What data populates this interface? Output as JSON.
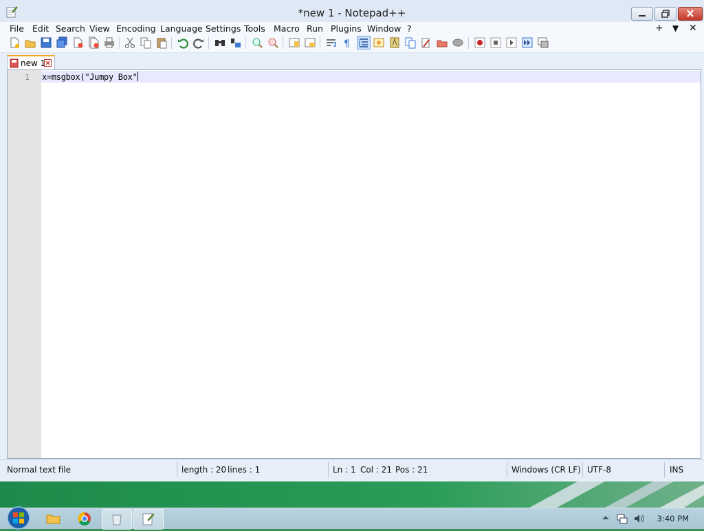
{
  "window": {
    "title": "*new 1 - Notepad++"
  },
  "menu": [
    "File",
    "Edit",
    "Search",
    "View",
    "Encoding",
    "Language",
    "Settings",
    "Tools",
    "Macro",
    "Run",
    "Plugins",
    "Window",
    "?"
  ],
  "menu_right": {
    "add": "+",
    "dropdown": "▼",
    "close": "✕"
  },
  "toolbar_icons": [
    "new-file-icon",
    "open-file-icon",
    "save-icon",
    "save-all-icon",
    "close-icon",
    "close-all-icon",
    "print-icon",
    "cut-icon",
    "copy-icon",
    "paste-icon",
    "undo-icon",
    "redo-icon",
    "find-icon",
    "replace-icon",
    "zoom-in-icon",
    "zoom-out-icon",
    "sync-vertical-icon",
    "sync-horizontal-icon",
    "word-wrap-icon",
    "show-all-chars-icon",
    "indent-guide-icon",
    "user-language-icon",
    "document-map-icon",
    "function-list-icon",
    "folder-workspace-icon",
    "document-list-icon",
    "monitoring-icon",
    "record-macro-icon",
    "stop-recording-icon",
    "play-macro-icon",
    "run-macro-multiple-icon",
    "save-macro-icon"
  ],
  "tab": {
    "label": "new 1"
  },
  "editor": {
    "line_number": "1",
    "code": "x=msgbox(\"Jumpy Box\""
  },
  "status": {
    "file_type": "Normal text file",
    "length": "length : 20",
    "lines": "lines : 1",
    "ln": "Ln : 1",
    "col": "Col : 21",
    "pos": "Pos : 21",
    "eol": "Windows (CR LF)",
    "encoding": "UTF-8",
    "mode": "INS"
  },
  "taskbar": {
    "time": "3:40 PM"
  },
  "colors": {
    "accent": "#3a6fd8",
    "tab_marker": "#f5a623",
    "current_line": "#e8e8ff"
  }
}
